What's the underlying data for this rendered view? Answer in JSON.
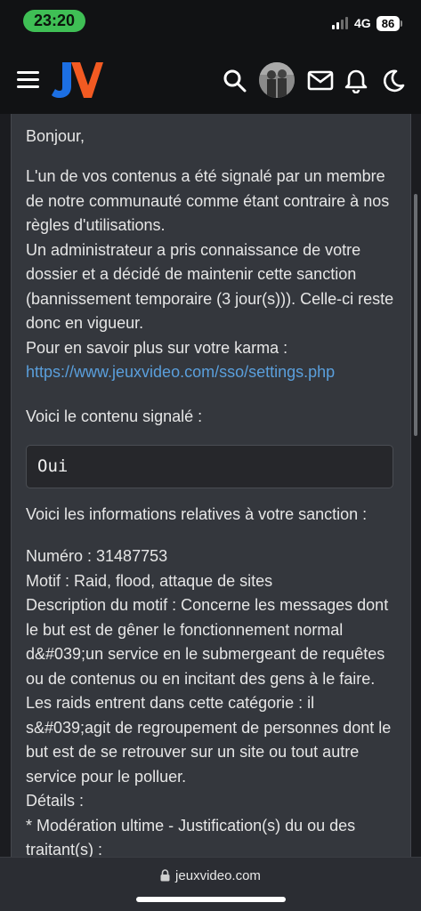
{
  "status_bar": {
    "time": "23:20",
    "network": "4G",
    "battery": "86",
    "colors": {
      "time_pill": "#3fbf55"
    }
  },
  "header": {
    "logo_text": "JV",
    "icons": [
      "menu-icon",
      "search-icon",
      "avatar",
      "mail-icon",
      "bell-icon",
      "moon-icon"
    ],
    "colors": {
      "logo_j": "#1c6fe3",
      "logo_v": "#f25a22"
    }
  },
  "message": {
    "greeting": "Bonjour,",
    "body_lines": [
      "L'un de vos contenus a été signalé par un membre de notre communauté comme étant contraire à nos règles d'utilisations.",
      "Un administrateur a pris connaissance de votre dossier et a décidé de maintenir cette sanction (bannissement temporaire (3 jour(s))). Celle-ci reste donc en vigueur.",
      "Pour en savoir plus sur votre karma :"
    ],
    "karma_link": "https://www.jeuxvideo.com/sso/settings.php",
    "reported_label": "Voici le contenu signalé :",
    "reported_content": "Oui",
    "sanction_label": "Voici les informations relatives à votre sanction :",
    "sanction_lines": [
      "Numéro : 31487753",
      "Motif : Raid, flood, attaque de sites",
      "Description du motif : Concerne les messages dont le but est de gêner le fonctionnement normal d&#039;un service en le submergeant de requêtes ou de contenus ou en incitant des gens à le faire. Les raids entrent dans cette catégorie : il s&#039;agit de regroupement de personnes dont le but est de se retrouver sur un site ou tout autre service pour le polluer.",
      "Détails :",
      "* Modération ultime - Justification(s) du ou des traitant(s) :"
    ],
    "colors": {
      "link": "#5a9fdc",
      "card": "#34373d"
    }
  },
  "browser": {
    "url": "jeuxvideo.com"
  }
}
